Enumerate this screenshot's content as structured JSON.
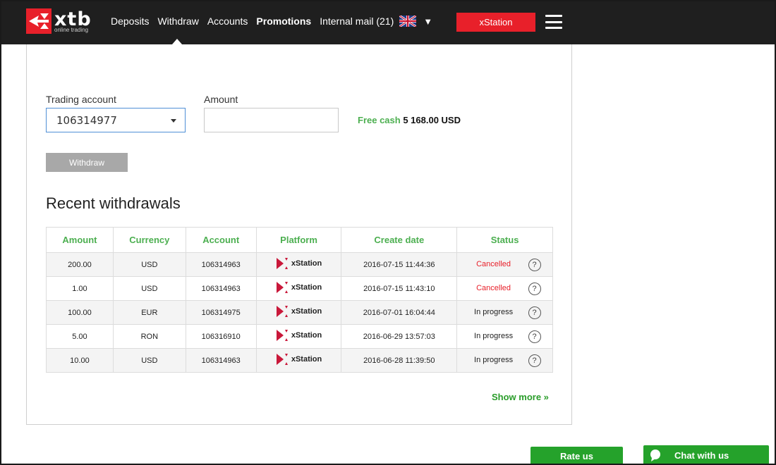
{
  "header": {
    "logo_text": "xtb",
    "logo_sub": "online trading",
    "nav": {
      "deposits": "Deposits",
      "withdraw": "Withdraw",
      "accounts": "Accounts",
      "promotions": "Promotions",
      "internal_mail": "Internal mail",
      "mail_count": "(21)"
    },
    "language_arrow": "▼",
    "xstation_button": "xStation",
    "menu_icon": "hamburger-icon",
    "flag_icon": "uk-flag-icon",
    "accent_color": "#e8202a",
    "bar_color": "#1f1f1f"
  },
  "form": {
    "trading_account_label": "Trading account",
    "trading_account_value": "106314977",
    "amount_label": "Amount",
    "amount_value": "",
    "free_cash_label": "Free cash",
    "free_cash_value": "5 168.00 USD",
    "withdraw_button": "Withdraw"
  },
  "recent": {
    "title": "Recent withdrawals",
    "columns": [
      "Amount",
      "Currency",
      "Account",
      "Platform",
      "Create date",
      "Status"
    ],
    "rows": [
      {
        "amount": "200.00",
        "currency": "USD",
        "account": "106314963",
        "platform": "xStation",
        "date": "2016-07-15 11:44:36",
        "status": "Cancelled"
      },
      {
        "amount": "1.00",
        "currency": "USD",
        "account": "106314963",
        "platform": "xStation",
        "date": "2016-07-15 11:43:10",
        "status": "Cancelled"
      },
      {
        "amount": "100.00",
        "currency": "EUR",
        "account": "106314975",
        "platform": "xStation",
        "date": "2016-07-01 16:04:44",
        "status": "In progress"
      },
      {
        "amount": "5.00",
        "currency": "RON",
        "account": "106316910",
        "platform": "xStation",
        "date": "2016-06-29 13:57:03",
        "status": "In progress"
      },
      {
        "amount": "10.00",
        "currency": "USD",
        "account": "106314963",
        "platform": "xStation",
        "date": "2016-06-28 11:39:50",
        "status": "In progress"
      }
    ],
    "help_symbol": "?",
    "show_more": "Show more »"
  },
  "footer": {
    "rate_us": "Rate us",
    "chat_with_us": "Chat with us",
    "button_color": "#25a22b"
  }
}
